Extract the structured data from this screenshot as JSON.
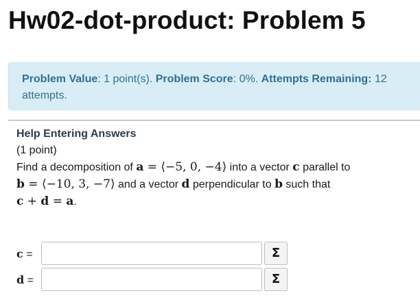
{
  "header": {
    "title": "Hw02-dot-product: Problem 5"
  },
  "info": {
    "value_label": "Problem Value",
    "value_text": ": 1 point(s).",
    "score_label": "Problem Score",
    "score_text": ": 0%.",
    "attempts_label": "Attempts Remaining:",
    "attempts_text": "12 attempts."
  },
  "problem": {
    "help_link": "Help Entering Answers",
    "points": "(1 point)",
    "text_1": "Find a decomposition of ",
    "a_sym": "a",
    "a_expr": " = ⟨−5, 0, −4⟩",
    "text_2": " into a vector ",
    "c_sym": "c",
    "text_3": " parallel to",
    "b_sym": "b",
    "b_expr": " = ⟨−10, 3, −7⟩",
    "text_4": " and a vector ",
    "d_sym": "d",
    "text_5": " perpendicular to ",
    "b_sym2": "b",
    "text_6": " such that",
    "eq_c": "c",
    "eq_plus": " + ",
    "eq_d": "d",
    "eq_eq": " = ",
    "eq_a": "a",
    "eq_end": "."
  },
  "answers": [
    {
      "var": "c",
      "suffix": " =",
      "value": "",
      "placeholder": "",
      "button": "Σ"
    },
    {
      "var": "d",
      "suffix": " =",
      "value": "",
      "placeholder": "",
      "button": "Σ"
    }
  ],
  "icons": {
    "equation_editor": "sigma-icon"
  },
  "colors": {
    "info_background": "#d9edf7",
    "info_text": "#31708f",
    "help_link": "#2a3d4c"
  }
}
